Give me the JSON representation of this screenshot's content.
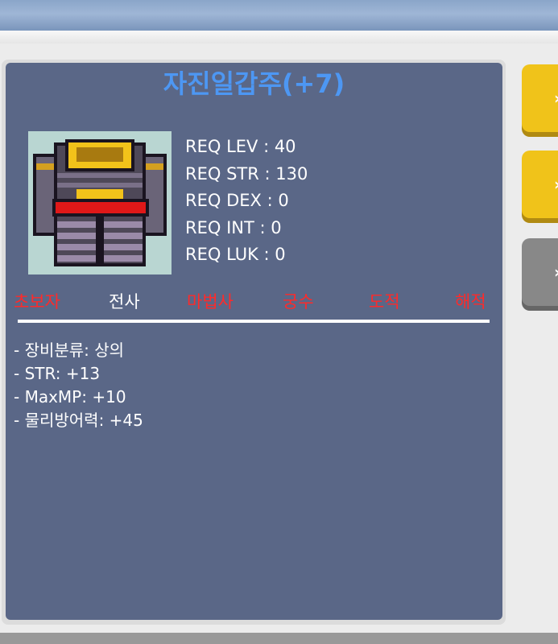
{
  "item": {
    "name": "자진일갑주(+7)",
    "image_icon": "purple-armor-icon",
    "requirements": [
      "REQ LEV : 40",
      "REQ STR : 130",
      "REQ DEX : 0",
      "REQ INT : 0",
      "REQ LUK : 0"
    ]
  },
  "jobs": [
    {
      "label": "초보자",
      "color": "#ff2a2a",
      "enabled": false
    },
    {
      "label": "전사",
      "color": "#ffffff",
      "enabled": true
    },
    {
      "label": "마법사",
      "color": "#ff2a2a",
      "enabled": false
    },
    {
      "label": "궁수",
      "color": "#ff2a2a",
      "enabled": false
    },
    {
      "label": "도적",
      "color": "#ff2a2a",
      "enabled": false
    },
    {
      "label": "해적",
      "color": "#ff2a2a",
      "enabled": false
    }
  ],
  "stats": [
    "- 장비분류: 상의",
    "- STR: +13",
    "- MaxMP: +10",
    "- 물리방어력: +45"
  ],
  "colors": {
    "card_bg": "#5a6787",
    "title": "#4d97f3",
    "button_yellow": "#f0c31a",
    "button_gray": "#888888"
  }
}
